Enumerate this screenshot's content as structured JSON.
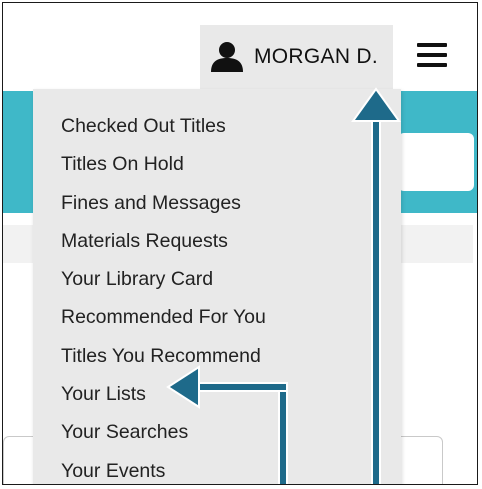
{
  "header": {
    "user_name": "MORGAN D.",
    "user_icon": "person-icon",
    "menu_icon": "hamburger-menu-icon"
  },
  "account_menu": {
    "items": [
      "Checked Out Titles",
      "Titles On Hold",
      "Fines and Messages",
      "Materials Requests",
      "Your Library Card",
      "Recommended For You",
      "Titles You Recommend",
      "Your Lists",
      "Your Searches",
      "Your Events"
    ]
  },
  "colors": {
    "teal_band": "#3fb8c8",
    "arrow": "#1e6a8a",
    "menu_background": "#e9e9e9"
  }
}
